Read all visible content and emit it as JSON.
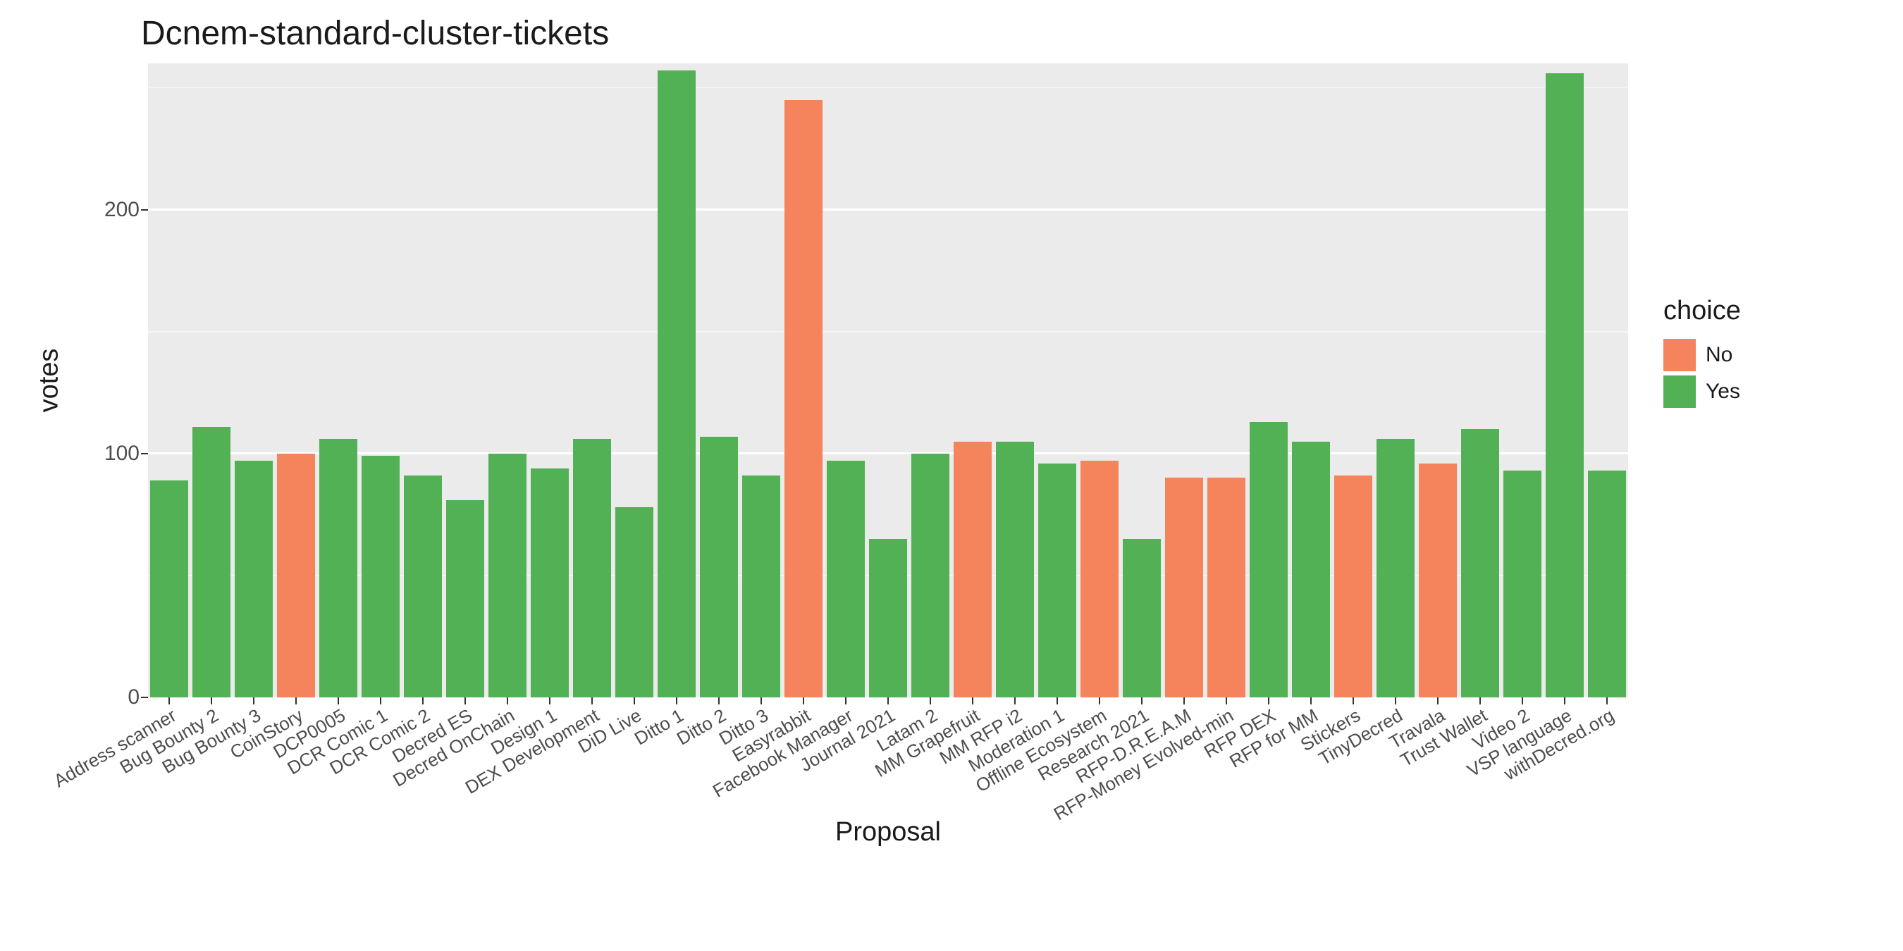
{
  "chart_data": {
    "type": "bar",
    "title": "Dcnem-standard-cluster-tickets",
    "xlabel": "Proposal",
    "ylabel": "votes",
    "legend_title": "choice",
    "ylim": [
      0,
      260
    ],
    "y_ticks": [
      0,
      100,
      200
    ],
    "colors": {
      "No": "#f5845c",
      "Yes": "#53b155"
    },
    "legend": [
      {
        "name": "No",
        "color": "#f5845c"
      },
      {
        "name": "Yes",
        "color": "#53b155"
      }
    ],
    "categories": [
      "Address scanner",
      "Bug Bounty 2",
      "Bug Bounty 3",
      "CoinStory",
      "DCP0005",
      "DCR Comic 1",
      "DCR Comic 2",
      "Decred ES",
      "Decred OnChain",
      "Design 1",
      "DEX Development",
      "DiD Live",
      "Ditto 1",
      "Ditto 2",
      "Ditto 3",
      "Easyrabbit",
      "Facebook Manager",
      "Journal 2021",
      "Latam 2",
      "MM Grapefruit",
      "MM RFP i2",
      "Moderation 1",
      "Offline Ecosystem",
      "Research 2021",
      "RFP-D.R.E.A.M",
      "RFP-Money Evolved-min",
      "RFP DEX",
      "RFP for MM",
      "Stickers",
      "TinyDecred",
      "Travala",
      "Trust Wallet",
      "Video 2",
      "VSP language",
      "withDecred.org"
    ],
    "series": [
      {
        "name": "votes",
        "values": [
          89,
          111,
          97,
          100,
          106,
          99,
          91,
          81,
          100,
          94,
          106,
          78,
          257,
          107,
          91,
          245,
          97,
          65,
          100,
          105,
          105,
          96,
          97,
          65,
          90,
          90,
          113,
          105,
          91,
          106,
          96,
          110,
          93,
          256,
          93
        ],
        "choice": [
          "Yes",
          "Yes",
          "Yes",
          "No",
          "Yes",
          "Yes",
          "Yes",
          "Yes",
          "Yes",
          "Yes",
          "Yes",
          "Yes",
          "Yes",
          "Yes",
          "Yes",
          "No",
          "Yes",
          "Yes",
          "Yes",
          "No",
          "Yes",
          "Yes",
          "No",
          "Yes",
          "No",
          "No",
          "Yes",
          "Yes",
          "No",
          "Yes",
          "No",
          "Yes",
          "Yes",
          "Yes",
          "Yes"
        ]
      }
    ]
  }
}
